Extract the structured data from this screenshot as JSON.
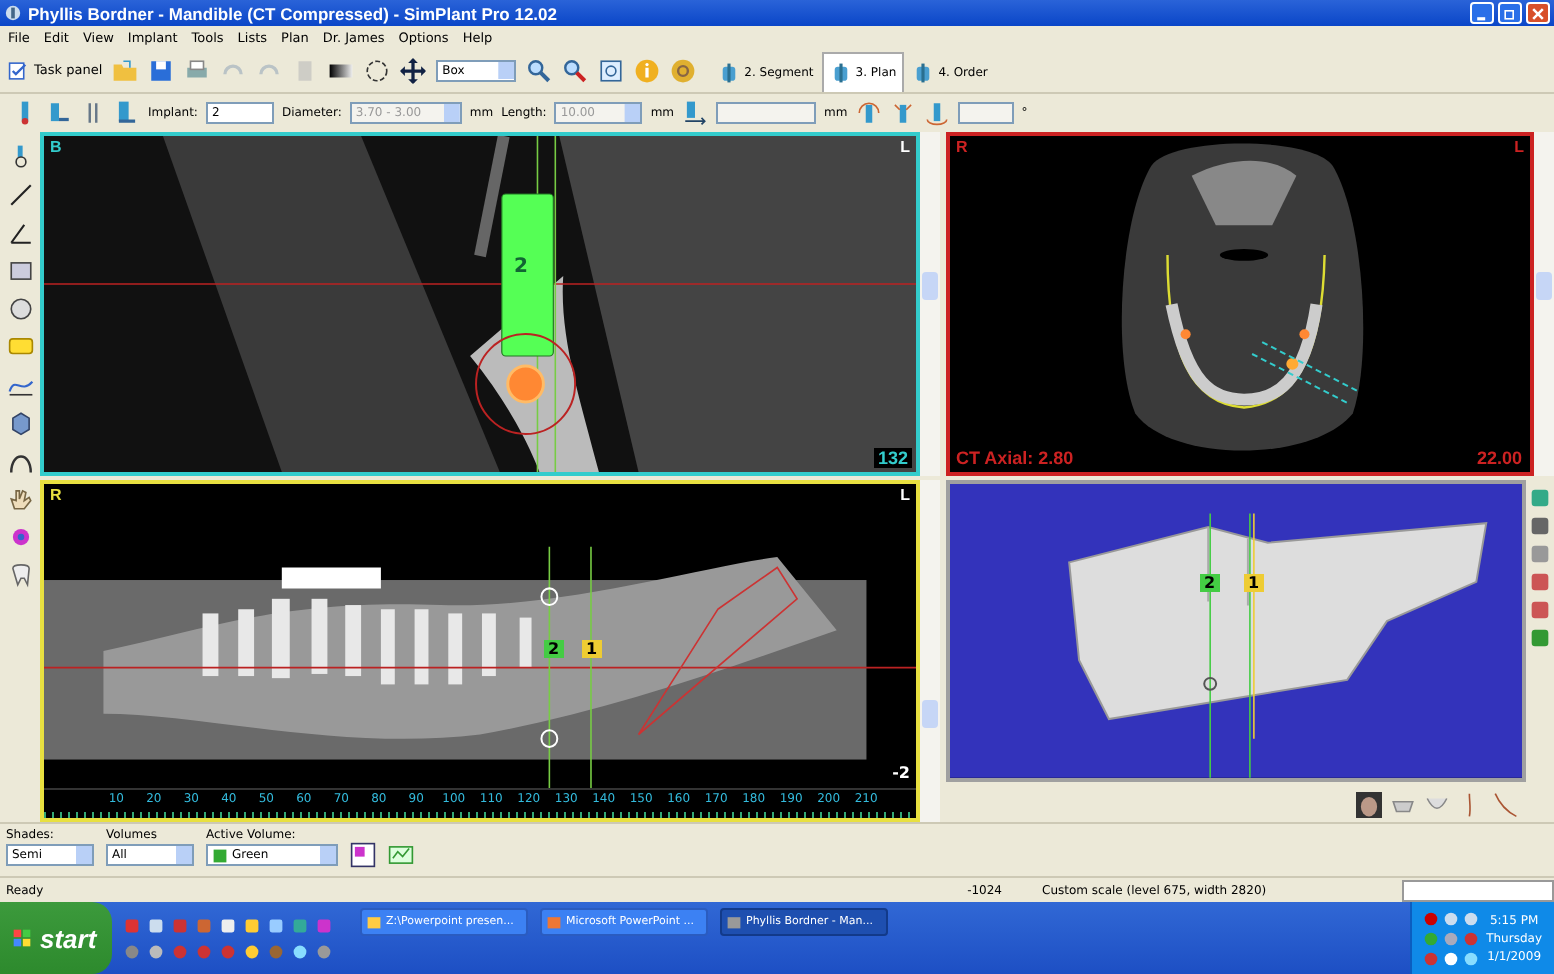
{
  "window": {
    "title": "Phyllis Bordner - Mandible (CT Compressed) - SimPlant Pro  12.02"
  },
  "menu": [
    "File",
    "Edit",
    "View",
    "Implant",
    "Tools",
    "Lists",
    "Plan",
    "Dr. James",
    "Options",
    "Help"
  ],
  "toolbar": {
    "task_panel": "Task panel",
    "view_mode": "Box",
    "steps": [
      {
        "label": "2. Segment",
        "selected": false
      },
      {
        "label": "3. Plan",
        "selected": true
      },
      {
        "label": "4. Order",
        "selected": false
      }
    ]
  },
  "implant_bar": {
    "implant_label": "Implant:",
    "implant": "2",
    "diameter_label": "Diameter:",
    "diameter": "3.70 - 3.00",
    "diameter_unit": "mm",
    "length_label": "Length:",
    "length": "10.00",
    "length_unit": "mm",
    "offset_unit": "mm",
    "angle_unit": "°"
  },
  "views": [
    {
      "kind": "cross",
      "color": "#33cccc",
      "corner_left": "B",
      "corner_right": "L",
      "implant_number": "2",
      "slice": "132"
    },
    {
      "kind": "axial",
      "color": "#cc2222",
      "corner_left": "R",
      "corner_right": "L",
      "caption": "CT Axial: 2.80",
      "value": "22.00"
    },
    {
      "kind": "panoramic",
      "color": "#e8e040",
      "corner_left": "R",
      "corner_right": "L",
      "implants": [
        "2",
        "1"
      ],
      "value": "-2",
      "ruler": [
        "10",
        "20",
        "30",
        "40",
        "50",
        "60",
        "70",
        "80",
        "90",
        "100",
        "110",
        "120",
        "130",
        "140",
        "150",
        "160",
        "170",
        "180",
        "190",
        "200",
        "210"
      ]
    },
    {
      "kind": "model",
      "color": "#a0a0a0",
      "implants": [
        "2",
        "1"
      ]
    }
  ],
  "volume_bar": {
    "shades_label": "Shades:",
    "shades": "Semi",
    "volumes_label": "Volumes",
    "volumes": "All",
    "active_label": "Active Volume:",
    "active": "Green"
  },
  "status_bar": {
    "message": "Ready",
    "value": "-1024",
    "scale": "Custom scale (level 675, width 2820)"
  },
  "taskbar": {
    "start": "start",
    "tasks": [
      {
        "label": "Z:\\Powerpoint presen...",
        "selected": false
      },
      {
        "label": "Microsoft PowerPoint ...",
        "selected": false
      },
      {
        "label": "Phyllis Bordner - Man...",
        "selected": true
      }
    ],
    "clock": [
      "5:15 PM",
      "Thursday",
      "1/1/2009"
    ]
  }
}
